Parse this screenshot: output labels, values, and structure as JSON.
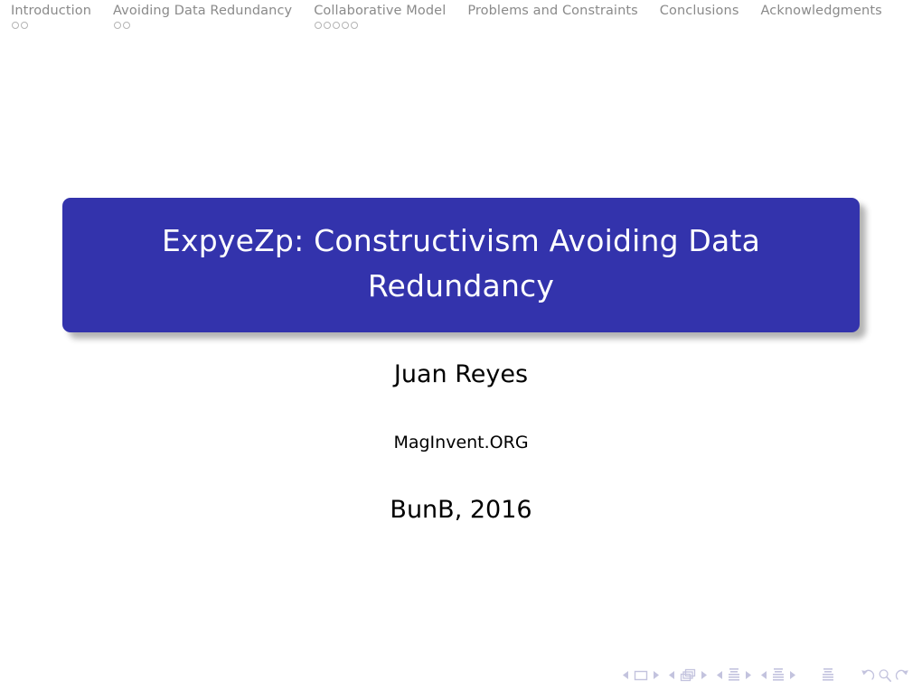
{
  "navigation": {
    "sections": [
      {
        "label": "Introduction",
        "dots": 2
      },
      {
        "label": "Avoiding Data Redundancy",
        "dots": 2
      },
      {
        "label": "Collaborative Model",
        "dots": 5
      },
      {
        "label": "Problems and Constraints",
        "dots": 0
      },
      {
        "label": "Conclusions",
        "dots": 0
      },
      {
        "label": "Acknowledgments",
        "dots": 0
      }
    ]
  },
  "slide": {
    "title": "ExpyeZp: Constructivism Avoiding Data Redundancy",
    "author": "Juan Reyes",
    "institute": "MagInvent.ORG",
    "date": "BunB, 2016"
  },
  "colors": {
    "title_block_background": "#3333ac",
    "title_text": "#ffffff",
    "navigation_text": "#8a8a8a",
    "navigation_dot_border": "#b4b4b4",
    "navigation_symbols": "#c3c3de",
    "body_text": "#000000",
    "page_background": "#ffffff"
  },
  "navigation_symbols": [
    {
      "name": "slide-navigation",
      "icon": "square-glyph",
      "prev": "◀",
      "next": "▶"
    },
    {
      "name": "frame-navigation",
      "icon": "stacked-frames-glyph",
      "prev": "◀",
      "next": "▶"
    },
    {
      "name": "subsection-navigation",
      "icon": "document-lines-glyph",
      "prev": "◀",
      "next": "▶"
    },
    {
      "name": "section-navigation",
      "icon": "document-lines-glyph",
      "prev": "◀",
      "next": "▶"
    },
    {
      "name": "presentation-navigation",
      "icon": "document-lines-glyph"
    },
    {
      "name": "back-navigation",
      "icon": "counterclockwise-arrow"
    },
    {
      "name": "search-navigation",
      "icon": "magnifying-glass-icon"
    },
    {
      "name": "forward-navigation",
      "icon": "clockwise-arrow"
    }
  ]
}
